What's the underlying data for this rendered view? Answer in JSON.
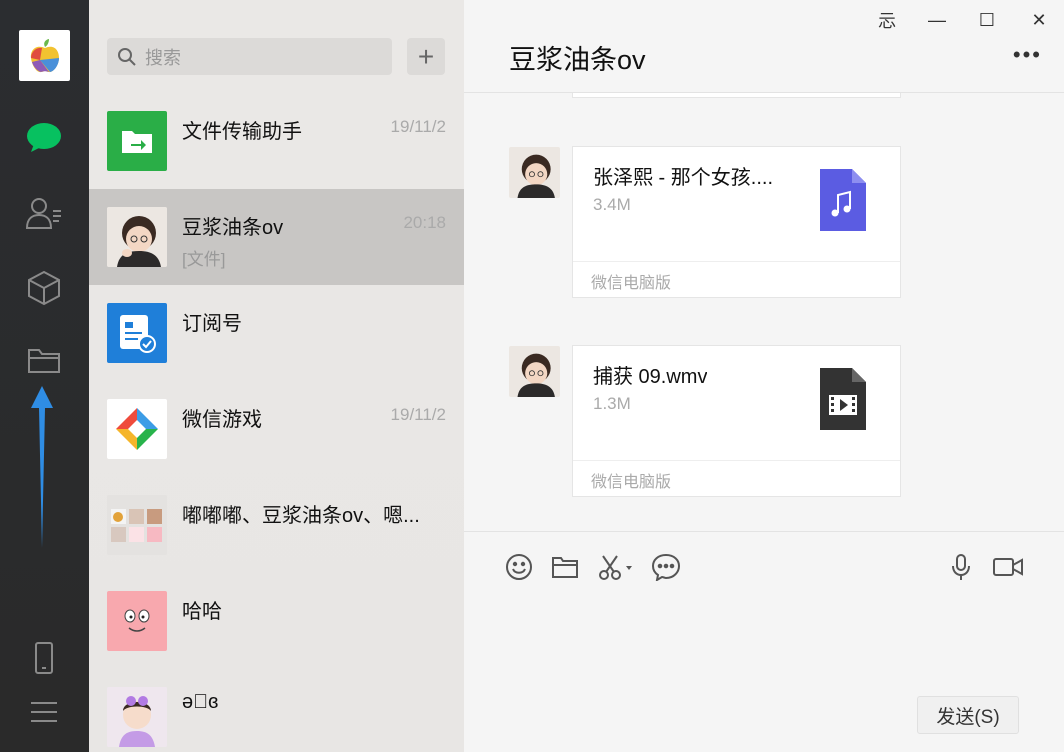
{
  "nav": {
    "icons": [
      "user-avatar-icon",
      "chat-icon",
      "contacts-icon",
      "collections-icon",
      "files-icon",
      "phone-icon",
      "menu-icon"
    ]
  },
  "search": {
    "placeholder": "搜索"
  },
  "add_button_label": "+",
  "chats": [
    {
      "name": "文件传输助手",
      "time": "19/11/2",
      "preview": ""
    },
    {
      "name": "豆浆油条ov",
      "time": "20:18",
      "preview": "[文件]"
    },
    {
      "name": "订阅号",
      "time": "",
      "preview": ""
    },
    {
      "name": "微信游戏",
      "time": "19/11/2",
      "preview": ""
    },
    {
      "name": "嘟嘟嘟、豆浆油条ov、嗯...",
      "time": "",
      "preview": ""
    },
    {
      "name": "哈哈",
      "time": "",
      "preview": ""
    },
    {
      "name": "ə⁠⃞ɞ",
      "time": "",
      "preview": ""
    }
  ],
  "window": {
    "pin": "忈",
    "minimize": "—",
    "maximize": "☐",
    "close": "✕"
  },
  "chat": {
    "title": "豆浆油条ov",
    "more": "•••",
    "messages": [
      {
        "file_name": "张泽熙 - 那个女孩....",
        "size": "3.4M",
        "source": "微信电脑版",
        "type": "music-file-icon"
      },
      {
        "file_name": "捕获 09.wmv",
        "size": "1.3M",
        "source": "微信电脑版",
        "type": "video-file-icon"
      }
    ]
  },
  "send_label": "发送(S)",
  "colors": {
    "accent_green": "#07c160",
    "music_file": "#5b5ce2",
    "video_file": "#333333",
    "annotation_arrow": "#2f8de4"
  }
}
